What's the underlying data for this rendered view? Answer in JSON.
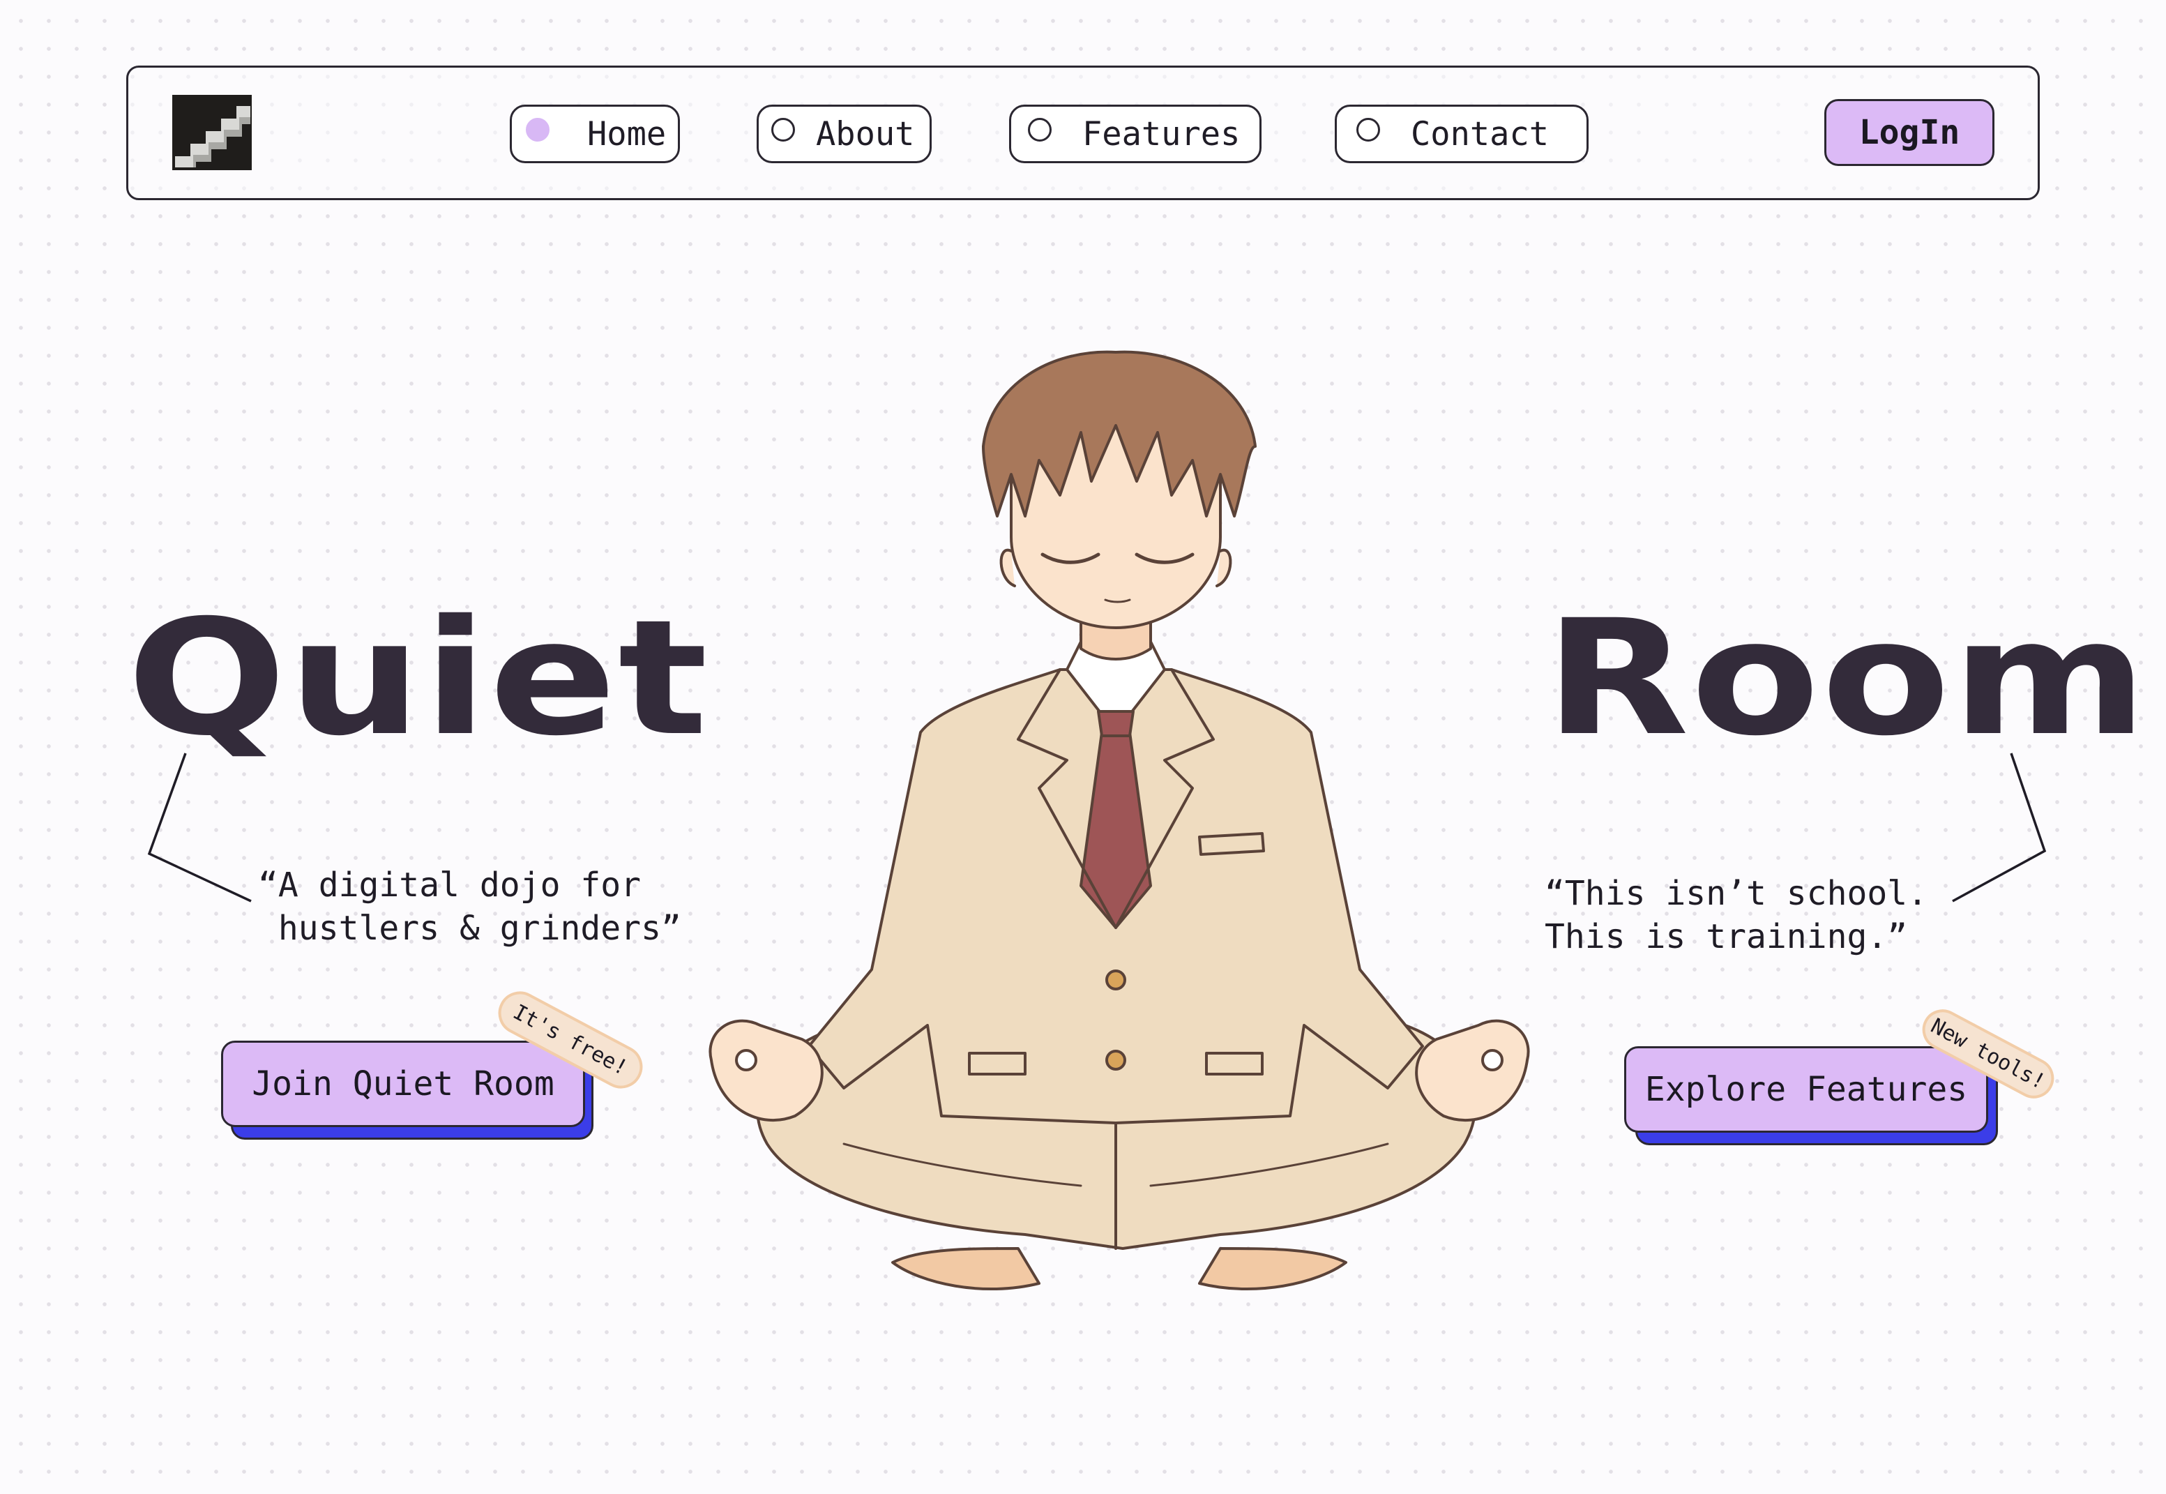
{
  "brand": {
    "logo_icon": "staircase-logo-icon"
  },
  "nav": {
    "items": [
      {
        "label": "Home",
        "active": true
      },
      {
        "label": "About",
        "active": false
      },
      {
        "label": "Features",
        "active": false
      },
      {
        "label": "Contact",
        "active": false
      }
    ],
    "login_label": "LogIn"
  },
  "hero": {
    "left_word": "Quiet",
    "right_word": "Room",
    "left_quote": "“A digital dojo for\n hustlers & grinders”",
    "right_quote": "“This isn’t school.\nThis is training.”",
    "illustration": "meditating-character-illustration"
  },
  "cta": {
    "join_label": "Join Quiet Room",
    "join_tag": "It's free!",
    "explore_label": "Explore Features",
    "explore_tag": "New tools!"
  },
  "colors": {
    "accent_purple": "#dcbaf6",
    "shadow_blue": "#3b3de8",
    "title_dark": "#332b3a",
    "tag_peach": "#f6e3d1"
  }
}
